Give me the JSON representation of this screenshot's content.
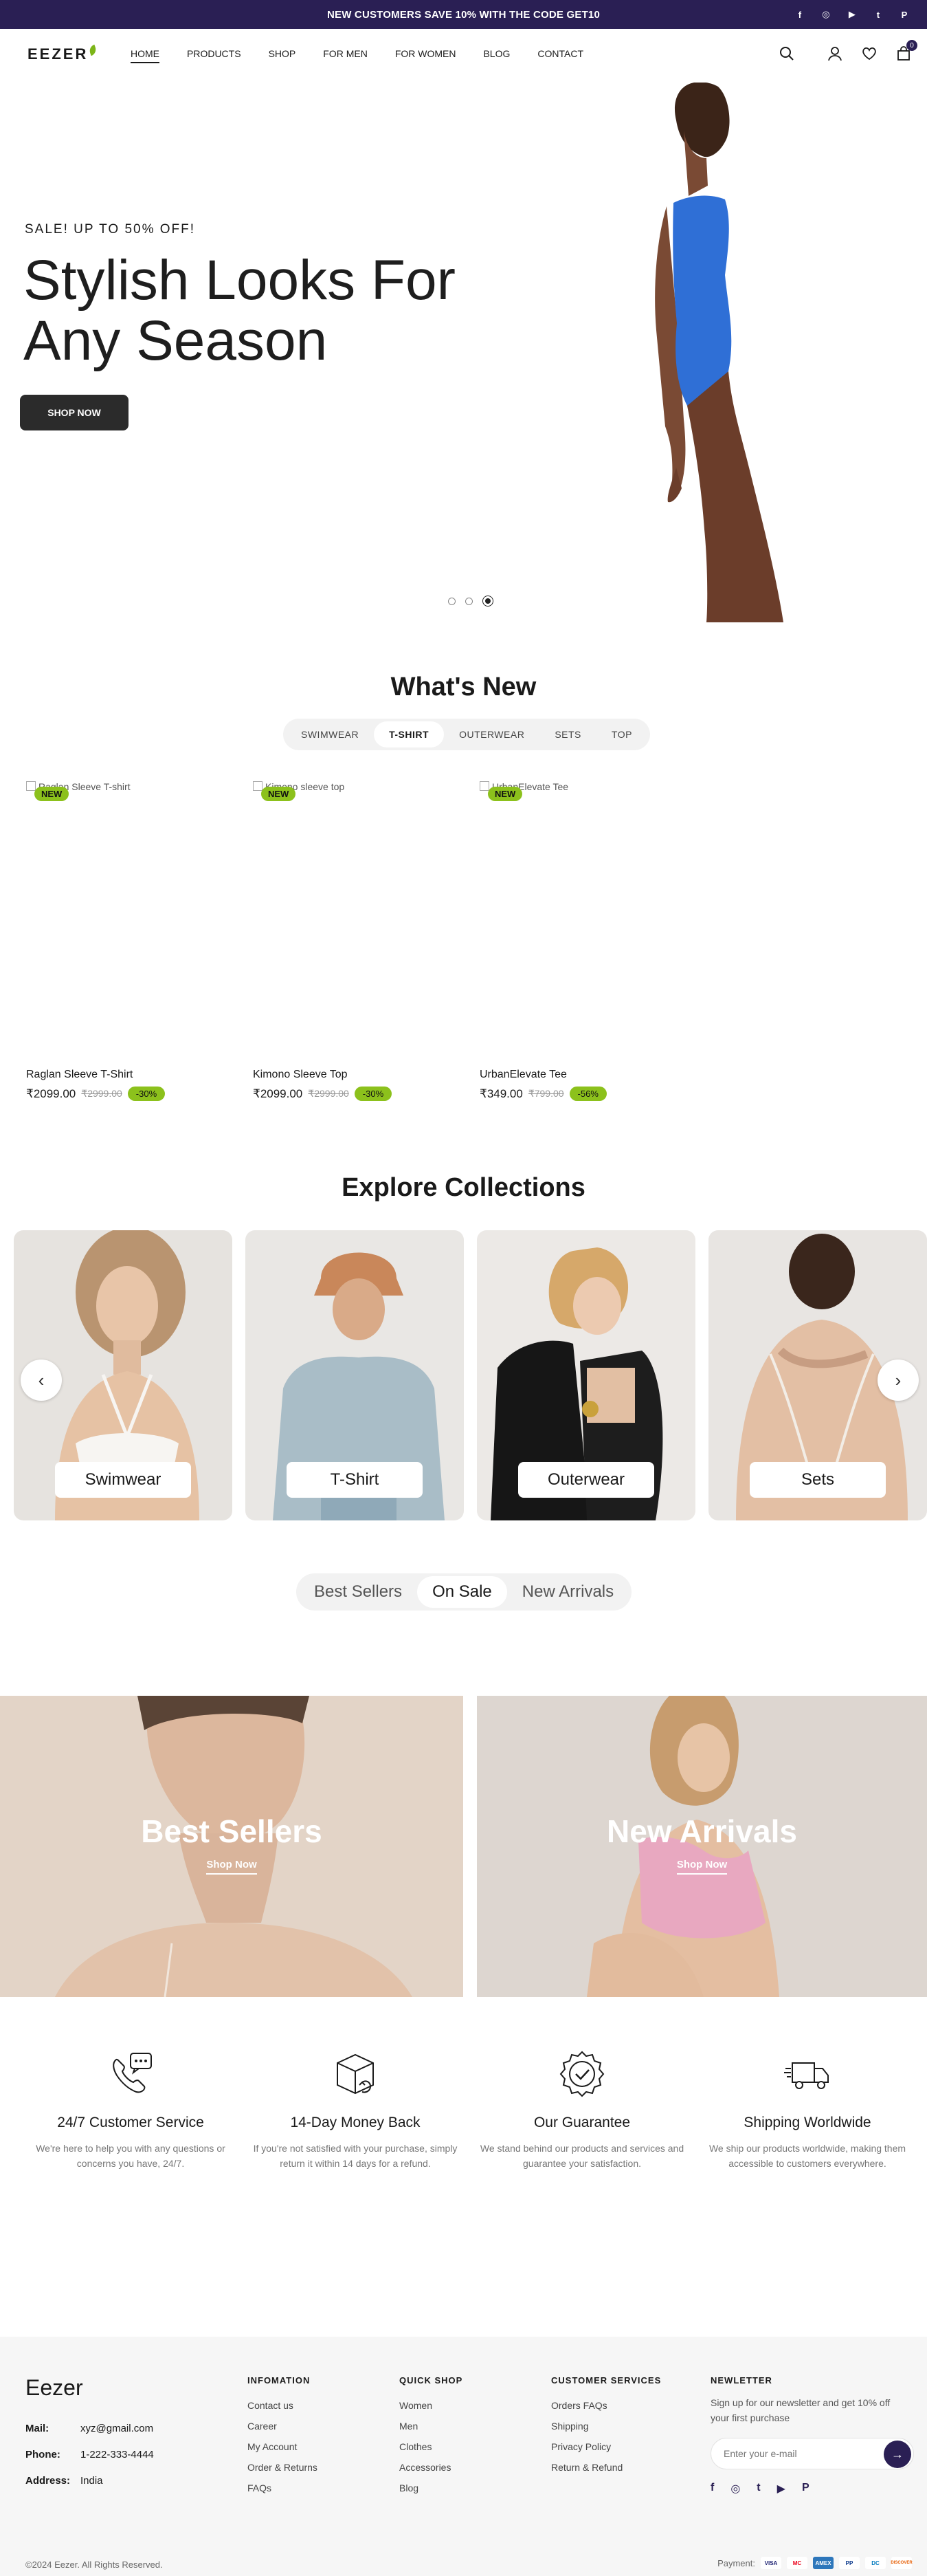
{
  "announcement": {
    "text": "NEW CUSTOMERS SAVE 10% WITH THE CODE GET10",
    "socials": [
      {
        "icon": "facebook-icon",
        "glyph": "f"
      },
      {
        "icon": "instagram-icon",
        "glyph": "◎"
      },
      {
        "icon": "youtube-icon",
        "glyph": "▶"
      },
      {
        "icon": "twitter-icon",
        "glyph": "t"
      },
      {
        "icon": "pinterest-icon",
        "glyph": "P"
      }
    ]
  },
  "header": {
    "logo": "EEZER",
    "nav": [
      "HOME",
      "PRODUCTS",
      "SHOP",
      "FOR MEN",
      "FOR WOMEN",
      "BLOG",
      "CONTACT"
    ],
    "cart_count": "0"
  },
  "hero": {
    "sale": "SALE! UP TO 50% OFF!",
    "title_line1": "Stylish Looks For",
    "title_line2": "Any Season",
    "button": "SHOP NOW",
    "slides": 3,
    "active_slide": 3
  },
  "whats_new": {
    "title": "What's New",
    "tabs": [
      "SWIMWEAR",
      "T-SHIRT",
      "OUTERWEAR",
      "SETS",
      "TOP"
    ],
    "selected_tab": "T-SHIRT",
    "badge": "NEW",
    "products": [
      {
        "alt": "Raglan Sleeve T-shirt",
        "name": "Raglan Sleeve T-Shirt",
        "price": "₹2099.00",
        "old_price": "₹2999.00",
        "discount": "-30%"
      },
      {
        "alt": "Kimono sleeve top",
        "name": "Kimono Sleeve Top",
        "price": "₹2099.00",
        "old_price": "₹2999.00",
        "discount": "-30%"
      },
      {
        "alt": "UrbanElevate Tee",
        "name": "UrbanElevate Tee",
        "price": "₹349.00",
        "old_price": "₹799.00",
        "discount": "-56%"
      }
    ]
  },
  "collections": {
    "title": "Explore Collections",
    "items": [
      "Swimwear",
      "T-Shirt",
      "Outerwear",
      "Sets"
    ]
  },
  "product_tabs": {
    "items": [
      "Best Sellers",
      "On Sale",
      "New Arrivals"
    ],
    "selected": "On Sale"
  },
  "banners": [
    {
      "title": "Best Sellers",
      "link": "Shop Now"
    },
    {
      "title": "New Arrivals",
      "link": "Shop Now"
    }
  ],
  "features": [
    {
      "icon": "customer-service-icon",
      "title": "24/7 Customer Service",
      "desc": "We're here to help you with any questions or concerns you have, 24/7."
    },
    {
      "icon": "money-back-icon",
      "title": "14-Day Money Back",
      "desc": "If you're not satisfied with your purchase, simply return it within 14 days for a refund."
    },
    {
      "icon": "guarantee-icon",
      "title": "Our Guarantee",
      "desc": "We stand behind our products and services and guarantee your satisfaction."
    },
    {
      "icon": "shipping-icon",
      "title": "Shipping Worldwide",
      "desc": "We ship our products worldwide, making them accessible to customers everywhere."
    }
  ],
  "footer": {
    "brand": "Eezer",
    "mail_label": "Mail:",
    "mail": "xyz@gmail.com",
    "phone_label": "Phone:",
    "phone": "1-222-333-4444",
    "address_label": "Address:",
    "address": "India",
    "information": {
      "title": "INFOMATION",
      "links": [
        "Contact us",
        "Career",
        "My Account",
        "Order & Returns",
        "FAQs"
      ]
    },
    "quick_shop": {
      "title": "QUICK SHOP",
      "links": [
        "Women",
        "Men",
        "Clothes",
        "Accessories",
        "Blog"
      ]
    },
    "customer_services": {
      "title": "CUSTOMER SERVICES",
      "links": [
        "Orders FAQs",
        "Shipping",
        "Privacy Policy",
        "Return & Refund"
      ]
    },
    "newsletter": {
      "title": "NEWLETTER",
      "text": "Sign up for our newsletter and get 10% off your first purchase",
      "placeholder": "Enter your e-mail"
    },
    "copyright": "©2024 Eezer. All Rights Reserved.",
    "payment_label": "Payment:",
    "payments": [
      {
        "name": "VISA",
        "bg": "#ffffff",
        "fg": "#1a1f71"
      },
      {
        "name": "MC",
        "bg": "#ffffff",
        "fg": "#eb001b"
      },
      {
        "name": "AMEX",
        "bg": "#2e77bb",
        "fg": "#ffffff"
      },
      {
        "name": "PP",
        "bg": "#ffffff",
        "fg": "#003087"
      },
      {
        "name": "DC",
        "bg": "#ffffff",
        "fg": "#0079be"
      },
      {
        "name": "DISCOVER",
        "bg": "#ffffff",
        "fg": "#e65c00"
      }
    ]
  },
  "colors": {
    "brand": "#2a1f54",
    "accent": "#8cc11c",
    "model_suit": "#2f6fd6"
  }
}
